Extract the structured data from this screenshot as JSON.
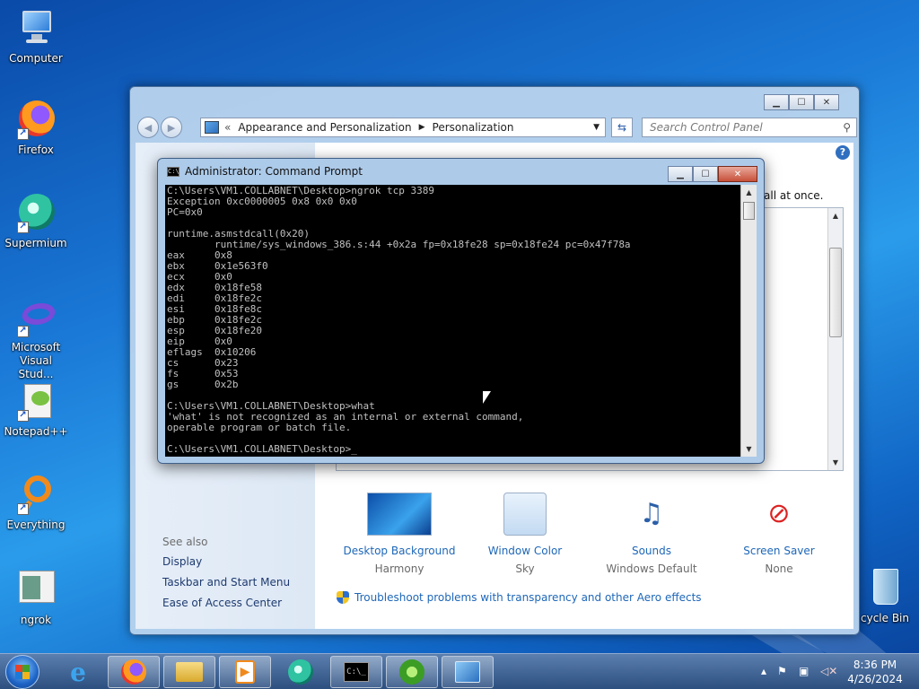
{
  "desktop": {
    "icons": [
      {
        "label": "Computer"
      },
      {
        "label": "Firefox"
      },
      {
        "label": "Supermium"
      },
      {
        "label": "Microsoft Visual Stud..."
      },
      {
        "label": "Notepad++"
      },
      {
        "label": "Everything"
      },
      {
        "label": "ngrok"
      },
      {
        "label": "cycle Bin"
      }
    ]
  },
  "control_panel": {
    "address": {
      "part1": "Appearance and Personalization",
      "part2": "Personalization"
    },
    "search_placeholder": "Search Control Panel",
    "partial_text": "all at once.",
    "see_also": {
      "heading": "See also",
      "links": [
        "Display",
        "Taskbar and Start Menu",
        "Ease of Access Center"
      ]
    },
    "items": [
      {
        "label": "Desktop Background",
        "value": "Harmony"
      },
      {
        "label": "Window Color",
        "value": "Sky"
      },
      {
        "label": "Sounds",
        "value": "Windows Default"
      },
      {
        "label": "Screen Saver",
        "value": "None"
      }
    ],
    "troubleshoot_link": "Troubleshoot problems with transparency and other Aero effects"
  },
  "cmd": {
    "title": "Administrator: Command Prompt",
    "lines": [
      "C:\\Users\\VM1.COLLABNET\\Desktop>ngrok tcp 3389",
      "Exception 0xc0000005 0x8 0x0 0x0",
      "PC=0x0",
      "",
      "runtime.asmstdcall(0x20)",
      "        runtime/sys_windows_386.s:44 +0x2a fp=0x18fe28 sp=0x18fe24 pc=0x47f78a",
      "eax     0x8",
      "ebx     0x1e563f0",
      "ecx     0x0",
      "edx     0x18fe58",
      "edi     0x18fe2c",
      "esi     0x18fe8c",
      "ebp     0x18fe2c",
      "esp     0x18fe20",
      "eip     0x0",
      "eflags  0x10206",
      "cs      0x23",
      "fs      0x53",
      "gs      0x2b",
      "",
      "C:\\Users\\VM1.COLLABNET\\Desktop>what",
      "'what' is not recognized as an internal or external command,",
      "operable program or batch file.",
      "",
      "C:\\Users\\VM1.COLLABNET\\Desktop>_"
    ]
  },
  "taskbar": {
    "time": "8:36 PM",
    "date": "4/26/2024",
    "buttons": [
      "start-button",
      "internet-explorer",
      "firefox",
      "file-explorer",
      "media-player",
      "supermium",
      "command-prompt",
      "windows-update",
      "control-panel"
    ]
  },
  "colors": {
    "accent": "#1e67b8",
    "cmd_bg": "#000000",
    "cmd_fg": "#c0c0c0"
  }
}
